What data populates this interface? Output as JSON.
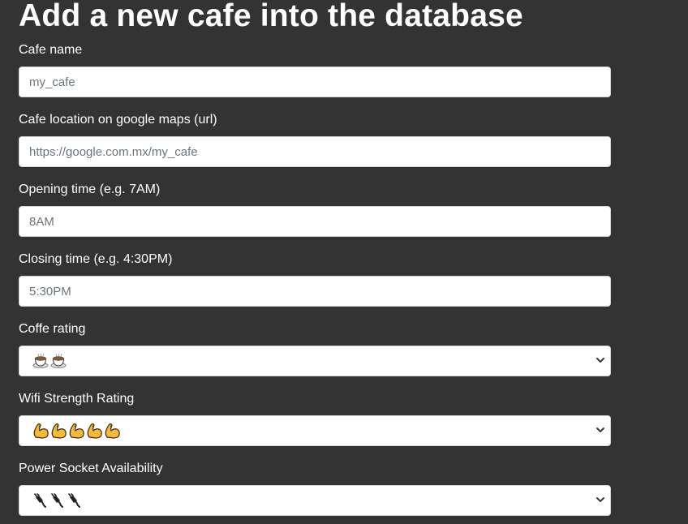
{
  "page": {
    "title": "Add a new cafe into the database"
  },
  "form": {
    "cafe_name": {
      "label": "Cafe name",
      "placeholder": "my_cafe"
    },
    "location": {
      "label": "Cafe location on google maps (url)",
      "placeholder": "https://google.com.mx/my_cafe"
    },
    "opening_time": {
      "label": "Opening time (e.g. 7AM)",
      "placeholder": "8AM"
    },
    "closing_time": {
      "label": "Closing time (e.g. 4:30PM)",
      "placeholder": "5:30PM"
    },
    "coffee_rating": {
      "label": "Coffe rating",
      "selected": "☕☕",
      "icon": "coffee-cup-icon",
      "count": 2
    },
    "wifi_rating": {
      "label": "Wifi Strength Rating",
      "selected": "💪💪💪💪💪",
      "icon": "flexed-biceps-icon",
      "count": 5
    },
    "power_rating": {
      "label": "Power Socket Availability",
      "selected": "🔌🔌🔌",
      "icon": "power-plug-icon",
      "count": 3
    }
  },
  "colors": {
    "background": "#333333",
    "input_background": "#ffffff",
    "placeholder": "#6c757d",
    "biceps": "#f4b93a"
  }
}
